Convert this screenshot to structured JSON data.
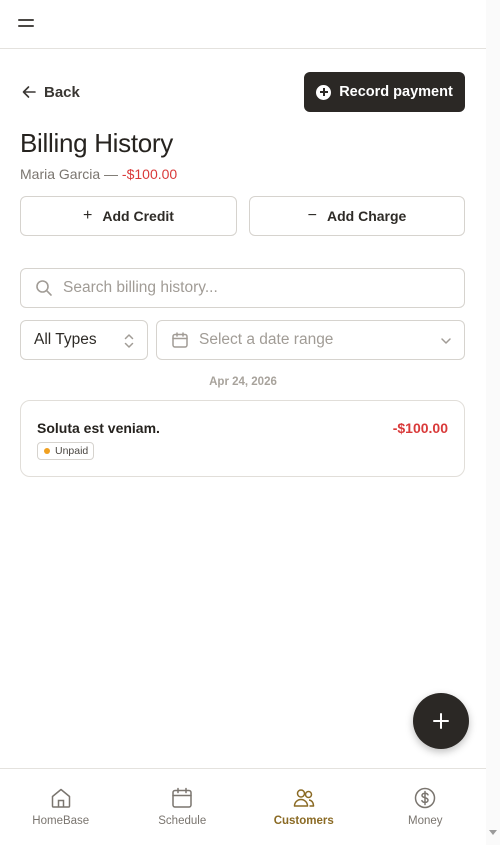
{
  "header": {
    "menu_icon": "menu-icon"
  },
  "back": {
    "label": "Back",
    "icon": "arrow-left-icon"
  },
  "record_payment": {
    "label": "Record payment",
    "icon": "plus-circle-icon"
  },
  "page": {
    "title": "Billing History",
    "customer_name": "Maria Garcia",
    "separator": " — ",
    "balance": "-$100.00"
  },
  "actions": {
    "add_credit": {
      "label": "Add Credit",
      "glyph": "+"
    },
    "add_charge": {
      "label": "Add Charge",
      "glyph": "−"
    }
  },
  "search": {
    "placeholder": "Search billing history...",
    "value": ""
  },
  "filters": {
    "type": {
      "value": "All Types"
    },
    "date_range": {
      "placeholder": "Select a date range"
    }
  },
  "groups": [
    {
      "date": "Apr 24, 2026",
      "transactions": [
        {
          "title": "Soluta est veniam.",
          "amount": "-$100.00",
          "status": "Unpaid"
        }
      ]
    }
  ],
  "fab": {
    "icon": "plus-icon"
  },
  "nav": {
    "items": [
      {
        "label": "HomeBase",
        "icon": "home-icon",
        "active": false
      },
      {
        "label": "Schedule",
        "icon": "calendar-icon",
        "active": false
      },
      {
        "label": "Customers",
        "icon": "users-icon",
        "active": true
      },
      {
        "label": "Money",
        "icon": "dollar-circle-icon",
        "active": false
      }
    ]
  },
  "colors": {
    "primary_dark": "#2b2825",
    "negative": "#d93a3a",
    "active_nav": "#8a6a24",
    "status_unpaid": "#f0a020"
  }
}
